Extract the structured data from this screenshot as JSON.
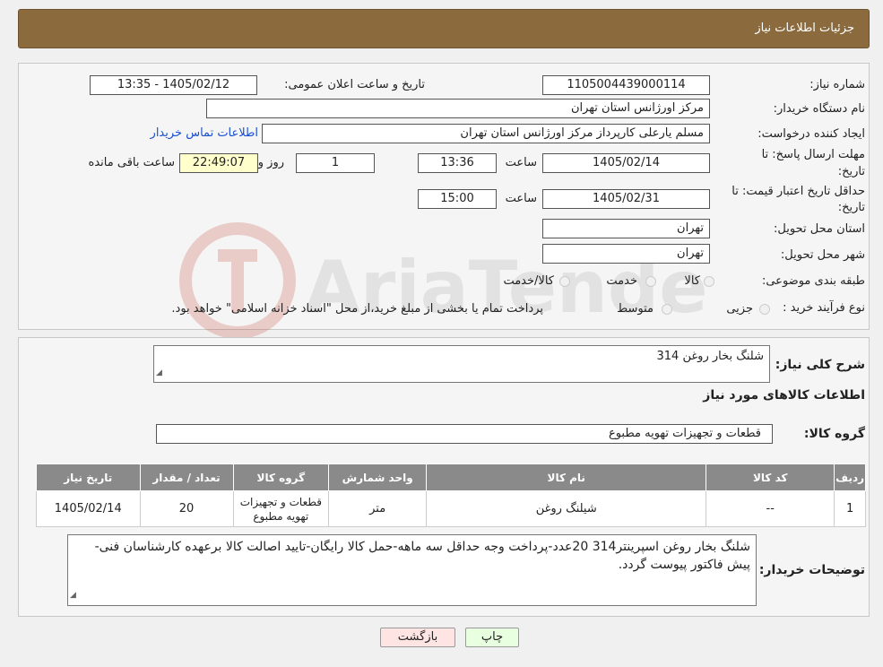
{
  "header": {
    "title": "جزئیات اطلاعات نیاز"
  },
  "form": {
    "need_number_label": "شماره نیاز:",
    "need_number": "1105004439000114",
    "announce_label": "تاریخ و ساعت اعلان عمومی:",
    "announce_value": "1405/02/12 - 13:35",
    "buyer_org_label": "نام دستگاه خریدار:",
    "buyer_org": "مرکز اورژانس استان تهران",
    "creator_label": "ایجاد کننده درخواست:",
    "creator": "مسلم یارعلی کارپرداز مرکز اورژانس استان تهران",
    "contact_link": "اطلاعات تماس خریدار",
    "deadline_label_1": "مهلت ارسال پاسخ: تا",
    "deadline_label_2": "تاریخ:",
    "deadline_date": "1405/02/14",
    "time_label": "ساعت",
    "deadline_time": "13:36",
    "days_value": "1",
    "days_label": "روز و",
    "remaining_time": "22:49:07",
    "remaining_label": "ساعت باقی مانده",
    "validity_label_1": "حداقل تاریخ اعتبار قیمت: تا",
    "validity_label_2": "تاریخ:",
    "validity_date": "1405/02/31",
    "validity_time": "15:00",
    "province_label": "استان محل تحویل:",
    "province": "تهران",
    "city_label": "شهر محل تحویل:",
    "city": "تهران",
    "category_label": "طبقه بندی موضوعی:",
    "category_options": [
      "کالا",
      "خدمت",
      "کالا/خدمت"
    ],
    "process_label": "نوع فرآیند خرید :",
    "process_options": [
      "جزیی",
      "متوسط"
    ],
    "process_note": "پرداخت تمام یا بخشی از مبلغ خرید،از محل \"اسناد خزانه اسلامی\" خواهد بود."
  },
  "summary": {
    "title_label": "شرح کلی نیاز:",
    "title_value": "شلنگ بخار روغن 314",
    "items_heading": "اطلاعات کالاهای مورد نیاز",
    "group_label": "گروه کالا:",
    "group_value": "قطعات و تجهیزات تهویه مطبوع"
  },
  "table": {
    "headers": [
      "ردیف",
      "کد کالا",
      "نام کالا",
      "واحد شمارش",
      "گروه کالا",
      "تعداد / مقدار",
      "تاریخ نیاز"
    ],
    "rows": [
      [
        "1",
        "--",
        "شیلنگ روغن",
        "متر",
        "قطعات و تجهیزات تهویه مطبوع",
        "20",
        "1405/02/14"
      ]
    ]
  },
  "notes": {
    "label": "توضیحات خریدار:",
    "text": "شلنگ بخار روغن اسپرینتر314      20عدد-پرداخت وجه حداقل سه ماهه-حمل کالا رایگان-تایید اصالت کالا برعهده کارشناسان فنی-پیش فاکتور پیوست گردد."
  },
  "buttons": {
    "print": "چاپ",
    "back": "بازگشت"
  },
  "watermark": {
    "text": "AriaTender.net"
  },
  "colors": {
    "header": "#8b6b3d",
    "table_header": "#8a8a8a",
    "link": "#1a4fd0",
    "remaining_bg": "#ffffcc"
  }
}
